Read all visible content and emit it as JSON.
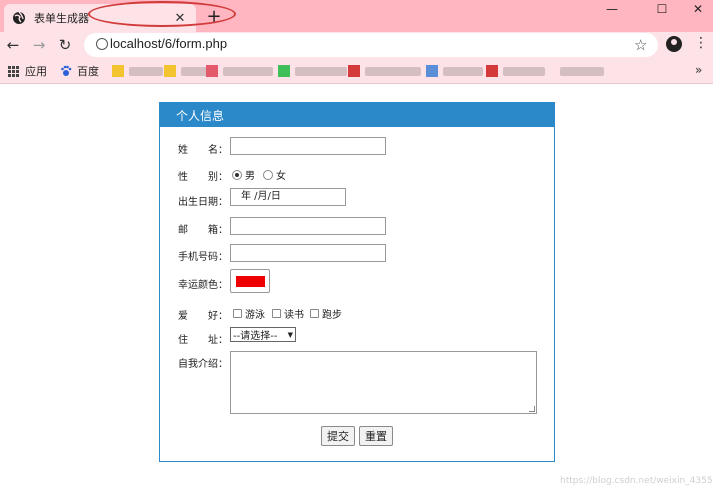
{
  "tab": {
    "title": "表单生成器",
    "close": "✕",
    "new_tab": "+"
  },
  "window": {
    "minimize": "—",
    "maximize": "☐",
    "close": "✕"
  },
  "nav": {
    "back": "←",
    "forward": "→",
    "reload": "↻",
    "url": "localhost/6/form.php",
    "star": "☆",
    "menu": "⋮"
  },
  "bookmarks": {
    "apps": "应用",
    "baidu": "百度",
    "more": "»"
  },
  "form": {
    "header": "个人信息",
    "name_label": "姓　　名：",
    "gender_label": "性　　别：",
    "gender_male": "男",
    "gender_female": "女",
    "birth_label": "出生日期：",
    "birth_placeholder": "年 /月/日",
    "email_label": "邮　　箱：",
    "phone_label": "手机号码：",
    "color_label": "幸运颜色：",
    "lucky_color": "#ee0000",
    "hobby_label": "爱　　好：",
    "hobbies": [
      "游泳",
      "读书",
      "跑步"
    ],
    "address_label": "住　　址：",
    "address_selected": "--请选择--",
    "intro_label": "自我介绍：",
    "submit": "提交",
    "reset": "重置"
  },
  "watermark": "https://blog.csdn.net/weixin_43559713"
}
